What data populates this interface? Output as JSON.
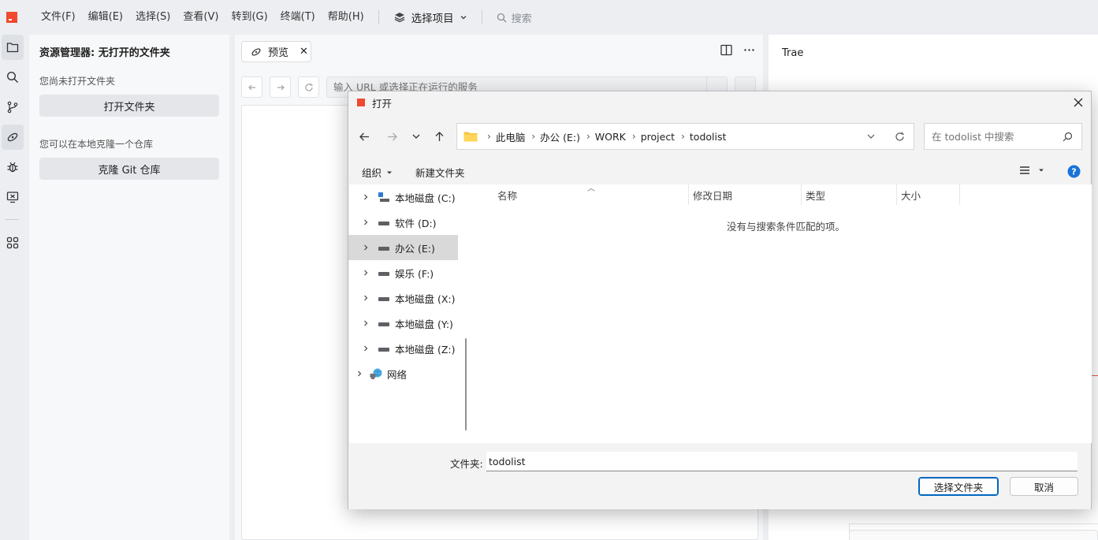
{
  "menu": {
    "items": [
      "文件(F)",
      "编辑(E)",
      "选择(S)",
      "查看(V)",
      "转到(G)",
      "终端(T)",
      "帮助(H)"
    ],
    "project_select": "选择项目",
    "search_placeholder": "搜索"
  },
  "explorer": {
    "title": "资源管理器: 无打开的文件夹",
    "no_folder_note": "您尚未打开文件夹",
    "open_folder_label": "打开文件夹",
    "clone_note": "您可以在本地克隆一个仓库",
    "clone_label": "克隆 Git 仓库"
  },
  "preview": {
    "tab_label": "预览",
    "url_placeholder": "输入 URL 或选择正在运行的服务"
  },
  "right_panel": {
    "title": "Trae"
  },
  "dialog": {
    "title": "打开",
    "breadcrumbs": [
      "此电脑",
      "办公 (E:)",
      "WORK",
      "project",
      "todolist"
    ],
    "search_placeholder": "在 todolist 中搜索",
    "organize_label": "组织",
    "new_folder_label": "新建文件夹",
    "nav_items": [
      {
        "label": "本地磁盘 (C:)",
        "icon": "windows-drive-icon"
      },
      {
        "label": "软件 (D:)",
        "icon": "drive-icon"
      },
      {
        "label": "办公 (E:)",
        "icon": "drive-icon",
        "selected": true
      },
      {
        "label": "娱乐 (F:)",
        "icon": "drive-icon"
      },
      {
        "label": "本地磁盘 (X:)",
        "icon": "drive-icon"
      },
      {
        "label": "本地磁盘 (Y:)",
        "icon": "drive-icon"
      },
      {
        "label": "本地磁盘 (Z:)",
        "icon": "drive-icon"
      },
      {
        "label": "网络",
        "icon": "network-icon"
      }
    ],
    "columns": [
      "名称",
      "修改日期",
      "类型",
      "大小"
    ],
    "empty_message": "没有与搜索条件匹配的项。",
    "folder_label": "文件夹:",
    "folder_value": "todolist",
    "select_folder_label": "选择文件夹",
    "cancel_label": "取消"
  },
  "colors": {
    "accent": "#0067c0",
    "brand": "#f0492f",
    "help": "#1a73d9"
  }
}
